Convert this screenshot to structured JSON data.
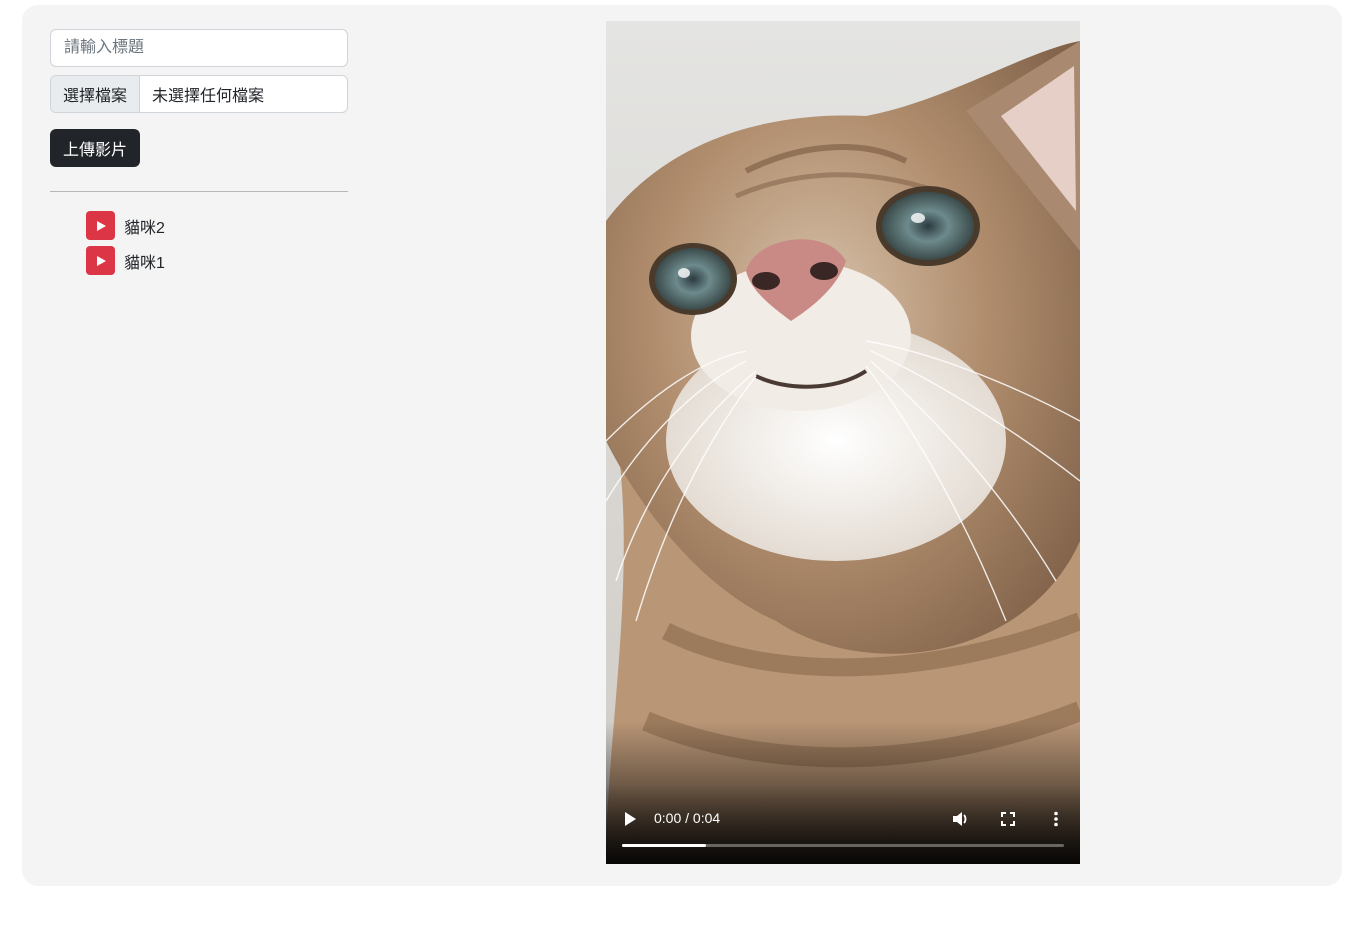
{
  "upload_form": {
    "title_placeholder": "請輸入標題",
    "title_value": "",
    "file_button_label": "選擇檔案",
    "file_status": "未選擇任何檔案",
    "upload_button_label": "上傳影片"
  },
  "video_list": {
    "items": [
      {
        "label": "貓咪2",
        "icon": "play-icon"
      },
      {
        "label": "貓咪1",
        "icon": "play-icon"
      }
    ]
  },
  "player": {
    "time": "0:00 / 0:04",
    "progress_fraction": 0.19,
    "icons": [
      "play-icon",
      "volume-icon",
      "fullscreen-icon",
      "more-options-icon"
    ]
  },
  "colors": {
    "panel_bg": "#f4f4f4",
    "accent_red": "#dc3545",
    "button_dark": "#212529"
  }
}
